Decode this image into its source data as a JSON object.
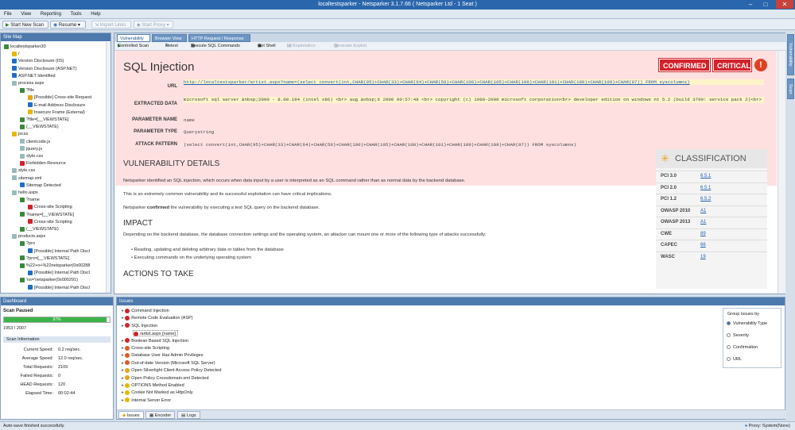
{
  "window": {
    "title": "localtestsparker - Netsparker 3.1.7.66  ( Netsparker Ltd - 1 Seat )"
  },
  "menu": [
    "File",
    "View",
    "Reporting",
    "Tools",
    "Help"
  ],
  "toolbar": {
    "start": "Start New Scan",
    "resume": "Resume",
    "import": "Import Links",
    "start_proxy": "Start Proxy"
  },
  "sitemap": {
    "title": "Site Map",
    "rows": [
      {
        "t": "localtestsparker30",
        "ind": 0,
        "c": "#3a8a3a"
      },
      {
        "t": "/",
        "ind": 1,
        "c": "#e6b800"
      },
      {
        "t": "Version Disclosure (IIS)",
        "ind": 1,
        "c": "#1f6fc4"
      },
      {
        "t": "Version Disclosure (ASP.NET)",
        "ind": 1,
        "c": "#1f6fc4"
      },
      {
        "t": "ASP.NET Identified",
        "ind": 1,
        "c": "#1f6fc4"
      },
      {
        "t": "process.aspx",
        "ind": 1,
        "c": "#9bb"
      },
      {
        "t": "?file",
        "ind": 2,
        "c": "#3a8a3a"
      },
      {
        "t": "[Possible] Cross-site Request",
        "ind": 3,
        "c": "#e8a317"
      },
      {
        "t": "E-mail Address Disclosure",
        "ind": 3,
        "c": "#1f6fc4"
      },
      {
        "t": "Insecure Frame (External)",
        "ind": 3,
        "c": "#e6b800"
      },
      {
        "t": "?file=[__VIEWSTATE]",
        "ind": 2,
        "c": "#3a8a3a"
      },
      {
        "t": "(__VIEWSTATE)",
        "ind": 2,
        "c": "#3a8a3a"
      },
      {
        "t": "jscss",
        "ind": 1,
        "c": "#e6b800"
      },
      {
        "t": "clientcode.js",
        "ind": 2,
        "c": "#9bb"
      },
      {
        "t": "jquery.js",
        "ind": 2,
        "c": "#9bb"
      },
      {
        "t": "style.css",
        "ind": 2,
        "c": "#9bb"
      },
      {
        "t": "Forbidden Resource",
        "ind": 2,
        "c": "#d2232a"
      },
      {
        "t": "style.css",
        "ind": 1,
        "c": "#9bb"
      },
      {
        "t": "sitemap.xml",
        "ind": 1,
        "c": "#9bb"
      },
      {
        "t": "Sitemap Detected",
        "ind": 2,
        "c": "#1f6fc4"
      },
      {
        "t": "hello.aspx",
        "ind": 1,
        "c": "#9bb"
      },
      {
        "t": "?name",
        "ind": 2,
        "c": "#3a8a3a"
      },
      {
        "t": "Cross-site Scripting",
        "ind": 3,
        "c": "#d2232a"
      },
      {
        "t": "?name=[__VIEWSTATE]",
        "ind": 2,
        "c": "#3a8a3a"
      },
      {
        "t": "Cross-site Scripting",
        "ind": 3,
        "c": "#d2232a"
      },
      {
        "t": "(__VIEWSTATE)",
        "ind": 2,
        "c": "#3a8a3a"
      },
      {
        "t": "products.aspx",
        "ind": 1,
        "c": "#9bb"
      },
      {
        "t": "?pro",
        "ind": 2,
        "c": "#3a8a3a"
      },
      {
        "t": "[Possible] Internal Path Discl",
        "ind": 3,
        "c": "#1f6fc4"
      },
      {
        "t": "?pro=[__VIEWSTATE]",
        "ind": 2,
        "c": "#3a8a3a"
      },
      {
        "t": "%22+n+%22netsparker(0x00288",
        "ind": 2,
        "c": "#3a8a3a"
      },
      {
        "t": "[Possible] Internal Path Discl",
        "ind": 3,
        "c": "#1f6fc4"
      },
      {
        "t": "'ns='netsparker(0x000291)",
        "ind": 2,
        "c": "#3a8a3a"
      },
      {
        "t": "[Possible] Internal Path Discl",
        "ind": 3,
        "c": "#1f6fc4"
      }
    ]
  },
  "main": {
    "tabs": [
      "Vulnerability",
      "Browser View",
      "HTTP Request / Response"
    ],
    "subtools": [
      "Controlled Scan",
      "Retest",
      "Execute SQL Commands",
      "Get Shell",
      "Lfi Exploitation",
      "Generate Exploit"
    ],
    "vuln_title": "SQL Injection",
    "badge_confirmed": "CONFIRMED",
    "badge_critical": "CRITICAL",
    "fields": {
      "url_label": "URL",
      "url": "http://localtestsparker/artist.aspx?name=(select convert(int,CHAR(95)+CHAR(33)+CHAR(64)+CHAR(50)+CHAR(100)+CHAR(105)+CHAR(108)+CHAR(101)+CHAR(109)+CHAR(109)+CHAR(97)) FROM syscolumns)",
      "data_label": "EXTRACTED DATA",
      "data": "microsoft sql server &nbsp;2000 - 8.00.194 (intel x86) <br> aug &nbsp;6 2000 00:57:48 <br> copyright (c) 1988-2000 microsoft corporation<br> developer edition on windows nt 5.2 (build 3790: service pack 2)<br>",
      "pname_label": "PARAMETER NAME",
      "pname": "name",
      "ptype_label": "PARAMETER TYPE",
      "ptype": "Querystring",
      "pattern_label": "ATTACK PATTERN",
      "pattern": "(select convert(int,CHAR(95)+CHAR(33)+CHAR(64)+CHAR(50)+CHAR(100)+CHAR(105)+CHAR(108)+CHAR(101)+CHAR(109)+CHAR(109)+CHAR(97)) FROM syscolumns)"
    },
    "details_title": "VULNERABILITY DETAILS",
    "details_p1": "Netsparker identified an SQL injection, which occurs when data input by a user is interpreted as an SQL command rather than as normal data by the backend database.",
    "details_p2": "This is an extremely common vulnerability and its successful exploitation can have critical implications.",
    "details_p3a": "Netsparker ",
    "details_p3b": "confirmed",
    "details_p3c": " the vulnerability by executing a test SQL query on the backend database.",
    "impact_title": "IMPACT",
    "impact_p": "Depending on the backend database, the database connection settings and the operating system, an attacker can mount one or more of the following type of attacks successfully:",
    "impact_b1": "Reading, updating and deleting arbitrary data or tables from the database",
    "impact_b2": "Executing commands on the underlying operating system",
    "actions_title": "ACTIONS TO TAKE",
    "classification": {
      "title": "CLASSIFICATION",
      "rows": [
        {
          "k": "PCI 3.0",
          "v": "6.5.1"
        },
        {
          "k": "PCI 2.0",
          "v": "6.5.1"
        },
        {
          "k": "PCI 1.2",
          "v": "6.5.2"
        },
        {
          "k": "OWASP 2010",
          "v": "A1"
        },
        {
          "k": "OWASP 2013",
          "v": "A1"
        },
        {
          "k": "CWE",
          "v": "89"
        },
        {
          "k": "CAPEC",
          "v": "66"
        },
        {
          "k": "WASC",
          "v": "19"
        }
      ]
    }
  },
  "right_tabs": [
    "Vulnerability",
    "Scan"
  ],
  "dashboard": {
    "title": "Dashboard",
    "scan_status": "Scan Paused",
    "progress_text": "97%",
    "progress": 0.97,
    "count": "1953 / 2007",
    "info_title": "Scan Information",
    "stats": [
      {
        "k": "Current Speed:",
        "v": "0.2 req/sec."
      },
      {
        "k": "Average Speed:",
        "v": "12.0 req/sec."
      },
      {
        "k": "Total Requests:",
        "v": "2109"
      },
      {
        "k": "Failed Requests:",
        "v": "0"
      },
      {
        "k": "HEAD Requests:",
        "v": "120"
      },
      {
        "k": "Elapsed Time:",
        "v": "00:02:44"
      }
    ]
  },
  "issues": {
    "title": "Issues",
    "rows": [
      {
        "t": "Command Injection",
        "c": "#d2232a",
        "ind": 0
      },
      {
        "t": "Remote Code Evaluation (ASP)",
        "c": "#d2232a",
        "ind": 0
      },
      {
        "t": "SQL Injection",
        "c": "#d2232a",
        "ind": 0
      },
      {
        "t": "/artist.aspx [name]",
        "c": "#d2232a",
        "ind": 1
      },
      {
        "t": "Boolean Based SQL Injection",
        "c": "#d2232a",
        "ind": 0
      },
      {
        "t": "Cross-site Scripting",
        "c": "#e05a1f",
        "ind": 0
      },
      {
        "t": "Database User Has Admin Privileges",
        "c": "#e05a1f",
        "ind": 0
      },
      {
        "t": "Out-of-date Version (Microsoft SQL Server)",
        "c": "#e05a1f",
        "ind": 0
      },
      {
        "t": "Open Silverlight Client Access Policy Detected",
        "c": "#e8a317",
        "ind": 0
      },
      {
        "t": "Open Policy Crossdomain.xml Detected",
        "c": "#e8a317",
        "ind": 0
      },
      {
        "t": "OPTIONS Method Enabled",
        "c": "#e6b800",
        "ind": 0
      },
      {
        "t": "Cookie Not Marked as HttpOnly",
        "c": "#e6b800",
        "ind": 0
      },
      {
        "t": "Internal Server Error",
        "c": "#e6b800",
        "ind": 0
      }
    ],
    "group_title": "Group Issues by",
    "group_opts": [
      "Vulnerability Type",
      "Severity",
      "Confirmation",
      "URL"
    ],
    "bottom_tabs": [
      "Issues",
      "Encoder",
      "Logs"
    ]
  },
  "status": {
    "left": "Auto-save finished successfully.",
    "right": "Proxy: System(None)"
  }
}
